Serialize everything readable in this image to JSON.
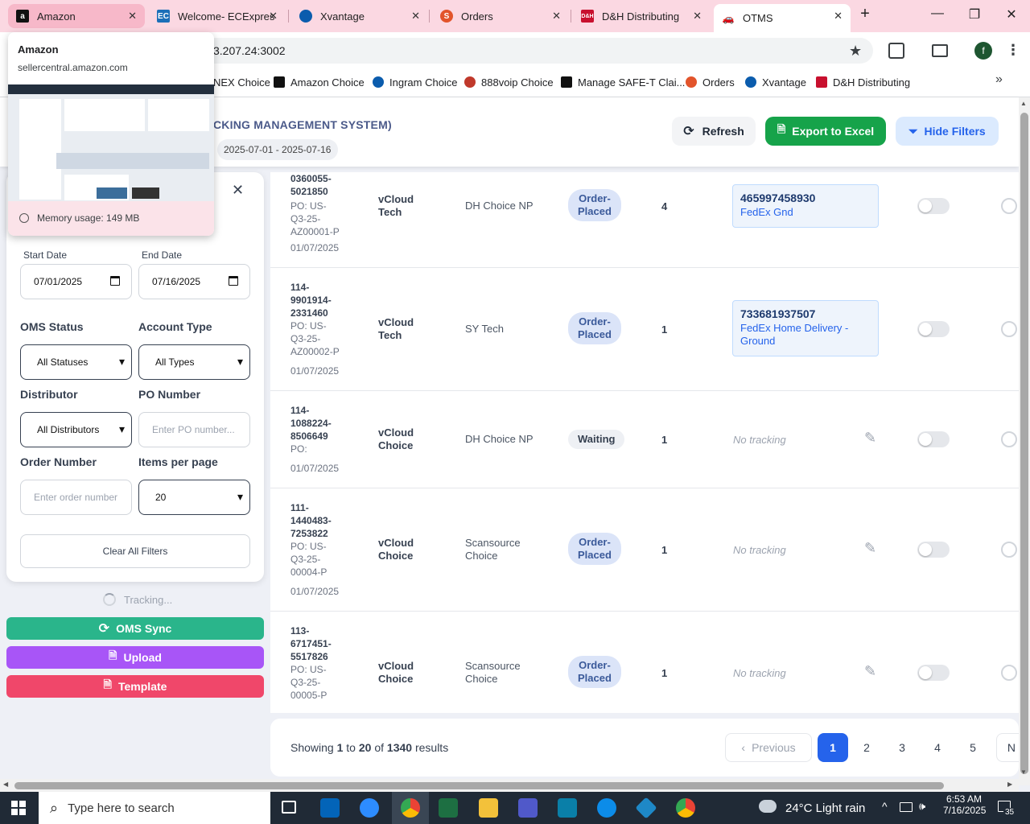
{
  "browser": {
    "tabs": [
      {
        "title": "Amazon",
        "icon": "amazon-icon"
      },
      {
        "title": "Welcome- ECExpres",
        "icon": "ec-icon"
      },
      {
        "title": "Xvantage",
        "icon": "xvantage-icon"
      },
      {
        "title": "Orders",
        "icon": "orders-icon"
      },
      {
        "title": "D&H Distributing",
        "icon": "dh-icon"
      },
      {
        "title": "OTMS",
        "icon": "otms-icon"
      }
    ],
    "url": "3.207.24:3002",
    "profile": "f",
    "bookmarks": [
      "NEX Choice",
      "Amazon Choice",
      "Ingram Choice",
      "888voip Choice",
      "Manage SAFE-T Clai...",
      "Orders",
      "Xvantage",
      "D&H Distributing"
    ]
  },
  "tab_preview": {
    "title": "Amazon",
    "domain": "sellercentral.amazon.com",
    "memory": "Memory usage: 149 MB"
  },
  "header": {
    "title": "CKING MANAGEMENT SYSTEM)",
    "date_range": "2025-07-01 - 2025-07-16",
    "refresh": "Refresh",
    "export": "Export to Excel",
    "hide_filters": "Hide Filters"
  },
  "filters": {
    "start_date_label": "Start Date",
    "start_date": "07/01/2025",
    "end_date_label": "End Date",
    "end_date": "07/16/2025",
    "oms_status_label": "OMS Status",
    "oms_status": "All Statuses",
    "account_type_label": "Account Type",
    "account_type": "All Types",
    "distributor_label": "Distributor",
    "distributor": "All Distributors",
    "po_label": "PO Number",
    "po_placeholder": "Enter PO number...",
    "order_label": "Order Number",
    "order_placeholder": "Enter order number",
    "items_label": "Items per page",
    "items_per_page": "20",
    "clear": "Clear All Filters"
  },
  "sidebar": {
    "tracking": "Tracking...",
    "oms_sync": "OMS Sync",
    "upload": "Upload",
    "template": "Template"
  },
  "orders": [
    {
      "id": [
        "0360055-",
        "5021850"
      ],
      "po": [
        "PO: US-",
        "Q3-25-",
        "AZ00001-P"
      ],
      "date": "01/07/2025",
      "account": [
        "vCloud",
        "Tech"
      ],
      "distributor": [
        "DH Choice NP"
      ],
      "status": [
        "Order-",
        "Placed"
      ],
      "qty": "4",
      "tracking": "465997458930",
      "carrier": [
        "FedEx Gnd"
      ]
    },
    {
      "id": [
        "114-",
        "9901914-",
        "2331460"
      ],
      "po": [
        "PO: US-",
        "Q3-25-",
        "AZ00002-P"
      ],
      "date": "01/07/2025",
      "account": [
        "vCloud",
        "Tech"
      ],
      "distributor": [
        "SY Tech"
      ],
      "status": [
        "Order-",
        "Placed"
      ],
      "qty": "1",
      "tracking": "733681937507",
      "carrier": [
        "FedEx Home Delivery -",
        "Ground"
      ]
    },
    {
      "id": [
        "114-",
        "1088224-",
        "8506649"
      ],
      "po": [
        "PO:"
      ],
      "date": "01/07/2025",
      "account": [
        "vCloud",
        "Choice"
      ],
      "distributor": [
        "DH Choice NP"
      ],
      "status": [
        "Waiting"
      ],
      "qty": "1",
      "tracking": "No tracking"
    },
    {
      "id": [
        "111-",
        "1440483-",
        "7253822"
      ],
      "po": [
        "PO: US-",
        "Q3-25-",
        "00004-P"
      ],
      "date": "01/07/2025",
      "account": [
        "vCloud",
        "Choice"
      ],
      "distributor": [
        "Scansource",
        "Choice"
      ],
      "status": [
        "Order-",
        "Placed"
      ],
      "qty": "1",
      "tracking": "No tracking"
    },
    {
      "id": [
        "113-",
        "6717451-",
        "5517826"
      ],
      "po": [
        "PO: US-",
        "Q3-25-",
        "00005-P"
      ],
      "date": "",
      "account": [
        "vCloud",
        "Choice"
      ],
      "distributor": [
        "Scansource",
        "Choice"
      ],
      "status": [
        "Order-",
        "Placed"
      ],
      "qty": "1",
      "tracking": "No tracking"
    }
  ],
  "pagination": {
    "showing": "Showing",
    "from": "1",
    "to_word": "to",
    "to": "20",
    "of_word": "of",
    "total": "1340",
    "results": "results",
    "previous": "Previous",
    "pages": [
      "1",
      "2",
      "3",
      "4",
      "5"
    ],
    "next": "N"
  },
  "taskbar": {
    "search": "Type here to search",
    "weather": "24°C  Light rain",
    "time": "6:53 AM",
    "date": "7/16/2025",
    "notif": "35"
  }
}
